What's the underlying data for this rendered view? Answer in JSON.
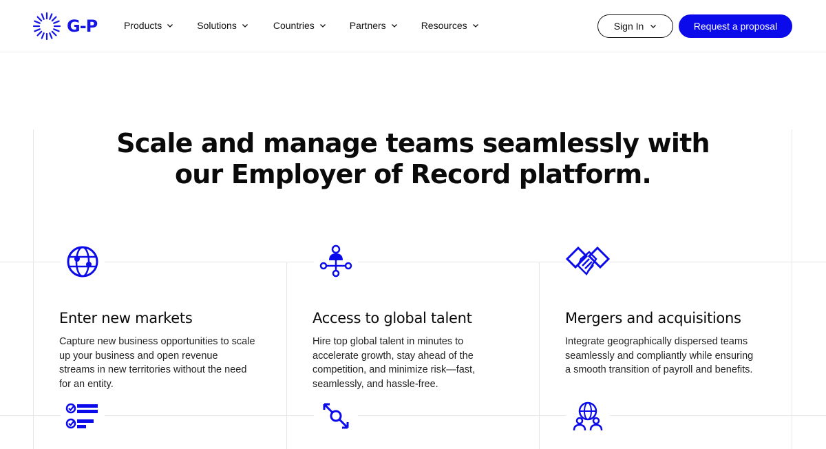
{
  "brand": {
    "logo_text": "G-P",
    "accent": "#0a0aea"
  },
  "nav": {
    "items": [
      {
        "label": "Products"
      },
      {
        "label": "Solutions"
      },
      {
        "label": "Countries"
      },
      {
        "label": "Partners"
      },
      {
        "label": "Resources"
      }
    ]
  },
  "header": {
    "signin_label": "Sign In",
    "proposal_label": "Request a proposal"
  },
  "hero": {
    "title_line1": "Scale and manage teams seamlessly with",
    "title_line2": "our Employer of Record platform."
  },
  "cards": [
    {
      "icon": "globe-icon",
      "title": "Enter new markets",
      "body": "Capture new business opportunities to scale up your business and open revenue streams in new territories without the need for an entity."
    },
    {
      "icon": "network-people-icon",
      "title": "Access to global talent",
      "body": "Hire top global talent in minutes to accelerate growth, stay ahead of the competition, and minimize risk—fast, seamlessly, and hassle-free."
    },
    {
      "icon": "handshake-icon",
      "title": "Mergers and acquisitions",
      "body": "Integrate geographically dispersed teams seamlessly and compliantly while ensuring a smooth transition of payroll and benefits."
    }
  ],
  "next_row_icons": [
    "checklist-icon",
    "transfer-icon",
    "global-team-icon"
  ]
}
